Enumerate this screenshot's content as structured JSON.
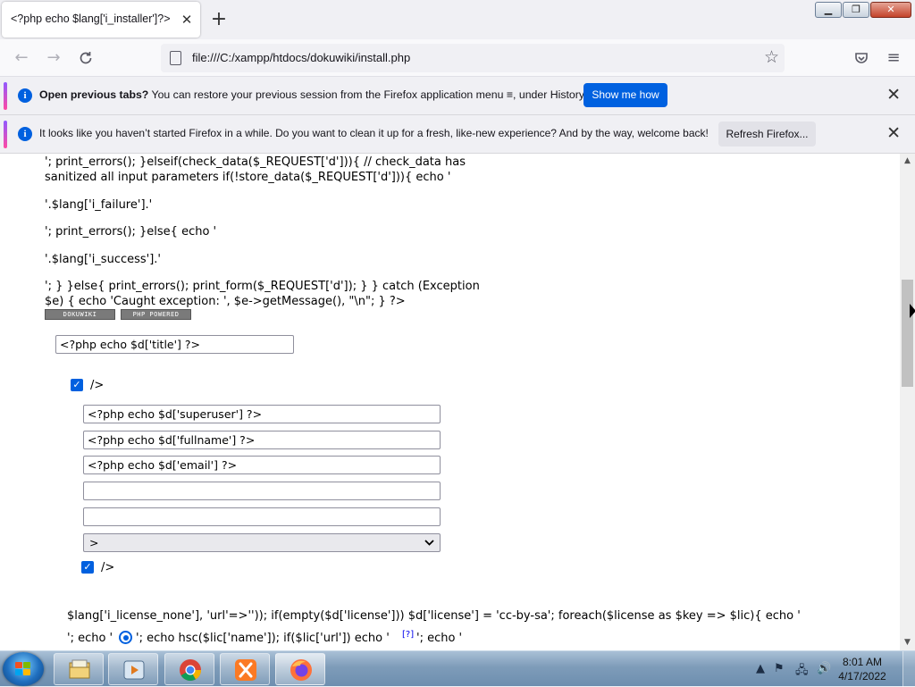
{
  "browser": {
    "tab_title": "<?php echo $lang['i_installer']?>",
    "tab_close_glyph": "✕",
    "new_tab_glyph": "+",
    "url": "file:///C:/xampp/htdocs/dokuwiki/install.php",
    "window_controls": {
      "minimize": "▁",
      "maximize": "❐",
      "close": "✕"
    }
  },
  "notifications": [
    {
      "bold": "Open previous tabs?",
      "text": " You can restore your previous session from the Firefox application menu ≡, under History.",
      "button": "Show me how"
    },
    {
      "bold": "",
      "text": "It looks like you haven’t started Firefox in a while. Do you want to clean it up for a fresh, like-new experience? And by the way, welcome back!",
      "button": "Refresh Firefox..."
    }
  ],
  "page": {
    "code_lines": [
      "'; print_errors(); }elseif(check_data($_REQUEST['d'])){ // check_data has",
      "sanitized all input parameters if(!store_data($_REQUEST['d'])){ echo '",
      "'.$lang['i_failure'].'",
      "'; print_errors(); }else{ echo '",
      "'.$lang['i_success'].'",
      "'; } }else{ print_errors(); print_form($_REQUEST['d']); } } catch (Exception",
      "$e) { echo 'Caught exception: ', $e->getMessage(), \"\\n\"; } ?>"
    ],
    "badges": [
      "DOKUWIKI",
      "PHP POWERED"
    ],
    "title_field": "<?php echo $d['title'] ?>",
    "acl_checkbox_label": "/>",
    "superuser_field": "<?php echo $d['superuser'] ?>",
    "fullname_field": "<?php echo $d['fullname'] ?>",
    "email_field": "<?php echo $d['email'] ?>",
    "password_field": "",
    "password_confirm_field": "",
    "policy_select": ">",
    "allowreg_checkbox_label": "/>",
    "license_line_1": "$lang['i_license_none'], 'url'=>'')); if(empty($d['license'])) $d['license'] = 'cc-by-sa'; foreach($license as $key => $lic){ echo '",
    "license_line_2a": "'; echo '",
    "license_line_2b": "'; echo hsc($lic['name']); if($lic['url']) echo '",
    "license_help_link": "[?]",
    "license_line_2c": "'; echo '"
  },
  "taskbar": {
    "clock_time": "8:01 AM",
    "clock_date": "4/17/2022",
    "apps": [
      "file-explorer-icon",
      "media-player-icon",
      "chrome-icon",
      "xampp-icon",
      "firefox-icon"
    ]
  }
}
